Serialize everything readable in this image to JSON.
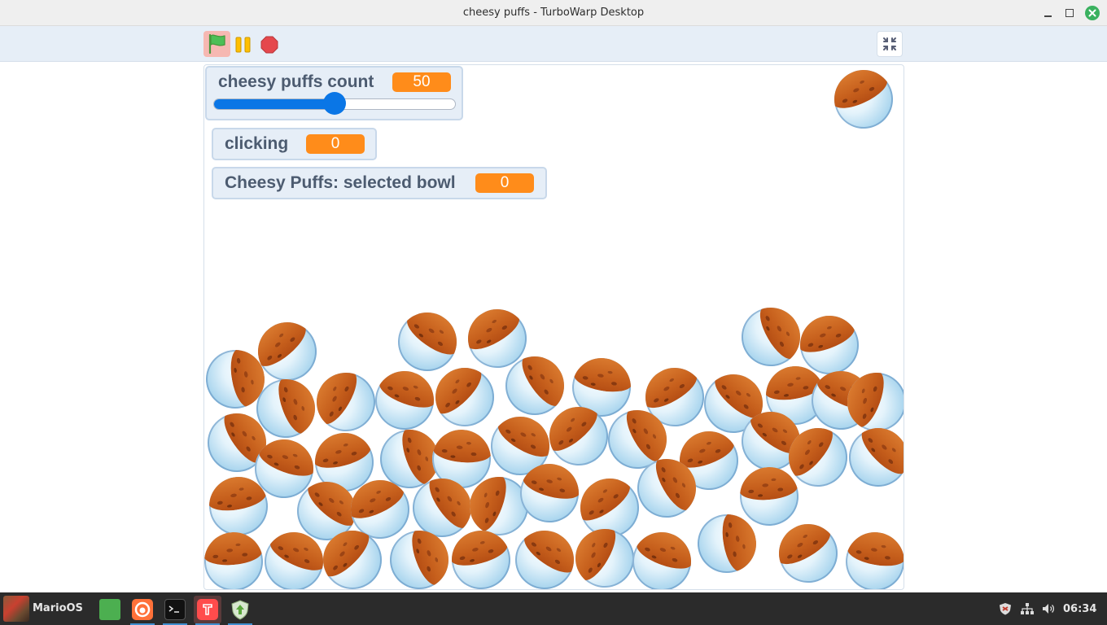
{
  "window": {
    "title": "cheesy puffs - TurboWarp Desktop"
  },
  "controls": {
    "green_flag_icon": "green-flag-icon",
    "pause_icon": "pause-icon",
    "stop_icon": "stop-icon",
    "exit_fullscreen_icon": "compress-icon"
  },
  "monitors": {
    "cheesy_puffs_count": {
      "label": "cheesy puffs count",
      "value": "50",
      "slider_fraction": 0.5
    },
    "clicking": {
      "label": "clicking",
      "value": "0"
    },
    "selected_bowl": {
      "label": "Cheesy Puffs: selected bowl",
      "value": "0"
    }
  },
  "colors": {
    "monitor_value": "#ff8c1a",
    "slider": "#0a76e6",
    "flag_active_bg": "#f6b8b2",
    "stop": "#e5484d",
    "pause": "#ffbf00"
  },
  "taskbar": {
    "start_label": "MarioOS",
    "apps": [
      "files-icon",
      "firefox-icon",
      "terminal-icon",
      "turbowarp-icon",
      "update-manager-icon"
    ],
    "tray": [
      "shield-icon",
      "network-icon",
      "volume-icon"
    ],
    "clock": "06:34"
  }
}
